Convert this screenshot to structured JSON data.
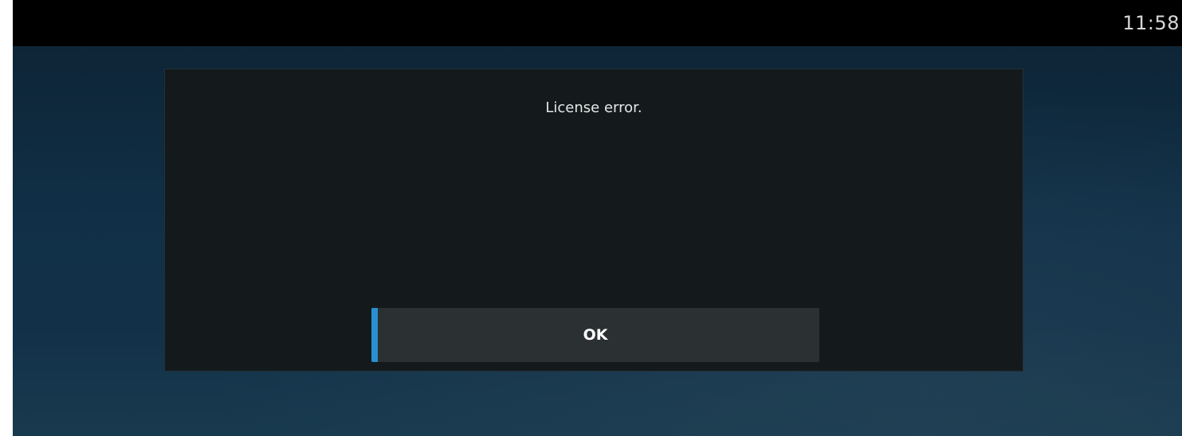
{
  "status_bar": {
    "time": "11:58"
  },
  "dialog": {
    "message": "License error.",
    "ok_label": "OK"
  },
  "colors": {
    "focus_accent": "#2a8fd1",
    "dialog_background": "#141a1c",
    "button_background": "#2b3033",
    "status_bar_background": "#000000"
  }
}
